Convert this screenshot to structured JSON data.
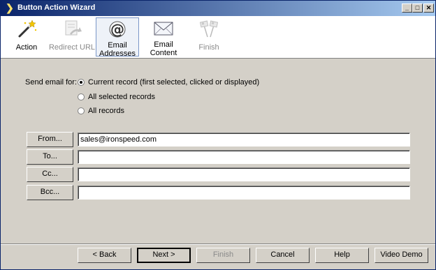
{
  "window": {
    "title": "Button Action Wizard"
  },
  "title_buttons": {
    "minimize": "_",
    "maximize": "□",
    "close": "✕"
  },
  "steps": [
    {
      "label": "Action",
      "icon": "magic-wand-icon",
      "state": "enabled"
    },
    {
      "label": "Redirect URL",
      "icon": "redirect-url-icon",
      "state": "disabled"
    },
    {
      "label": "Email Addresses",
      "icon": "at-sign-icon",
      "state": "active"
    },
    {
      "label": "Email Content",
      "icon": "envelope-icon",
      "state": "enabled"
    },
    {
      "label": "Finish",
      "icon": "checkered-flag-icon",
      "state": "disabled"
    }
  ],
  "send_email": {
    "label": "Send email for:",
    "options": [
      {
        "label": "Current record (first selected, clicked or displayed)",
        "checked": true
      },
      {
        "label": "All selected records",
        "checked": false
      },
      {
        "label": "All records",
        "checked": false
      }
    ]
  },
  "addresses": [
    {
      "button": "From...",
      "value": "sales@ironspeed.com"
    },
    {
      "button": "To...",
      "value": ""
    },
    {
      "button": "Cc...",
      "value": ""
    },
    {
      "button": "Bcc...",
      "value": ""
    }
  ],
  "footer": {
    "back": "< Back",
    "next": "Next >",
    "finish": "Finish",
    "cancel": "Cancel",
    "help": "Help",
    "video_demo": "Video Demo"
  },
  "colors": {
    "titlebar_start": "#0a246a",
    "titlebar_end": "#a6caf0",
    "dialog_bg": "#d4d0c8"
  }
}
